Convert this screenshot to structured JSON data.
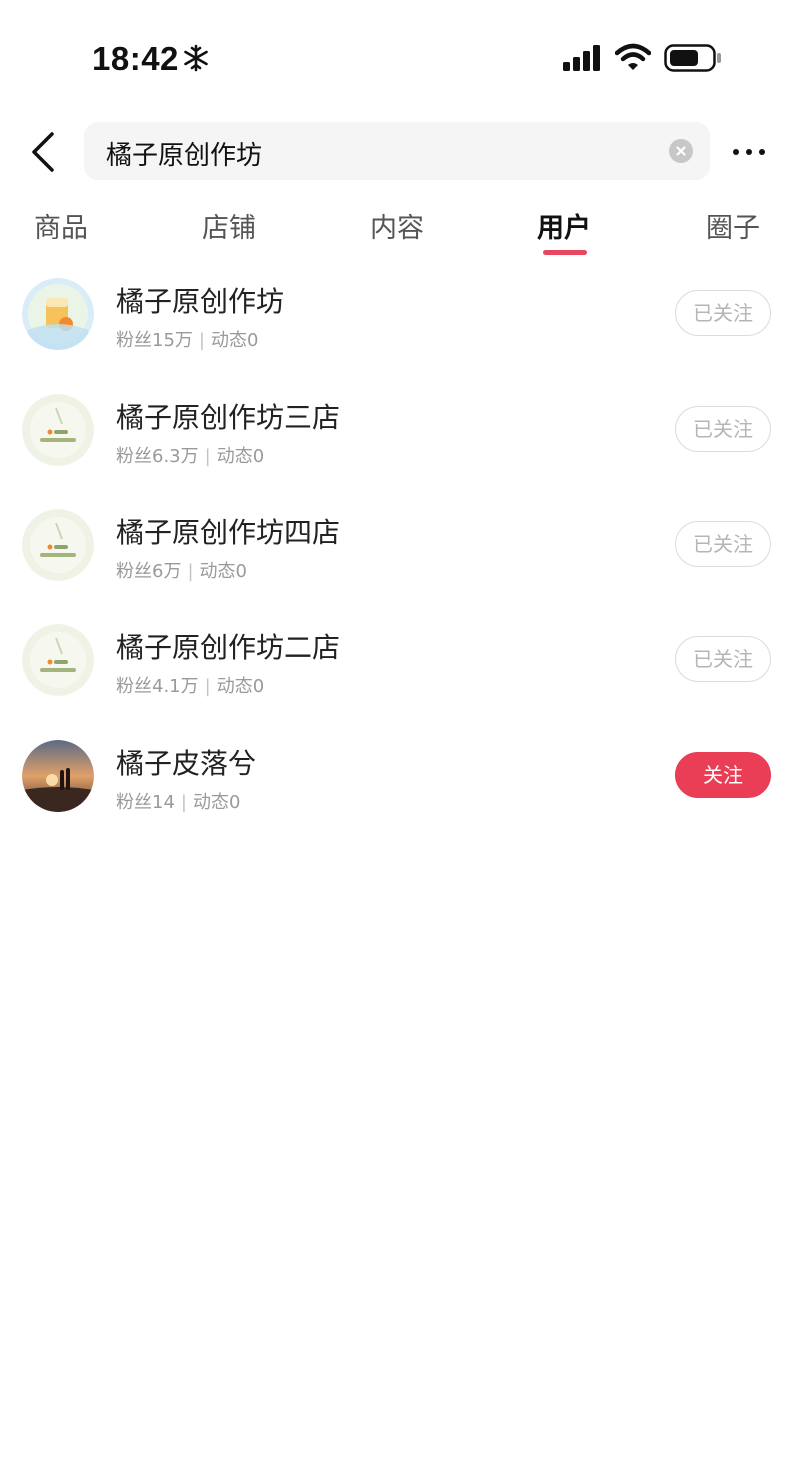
{
  "status_bar": {
    "time": "18:42",
    "extra_icon": "snowflake-icon",
    "signal_icon": "cellular-signal-icon",
    "wifi_icon": "wifi-icon",
    "battery_icon": "battery-icon"
  },
  "header": {
    "back_icon": "chevron-left-icon",
    "search_value": "橘子原创作坊",
    "clear_icon": "clear-circle-icon",
    "more_icon": "more-dots-icon"
  },
  "tabs": [
    {
      "label": "商品",
      "active": false
    },
    {
      "label": "店铺",
      "active": false
    },
    {
      "label": "内容",
      "active": false
    },
    {
      "label": "用户",
      "active": true
    },
    {
      "label": "圈子",
      "active": false
    }
  ],
  "users": [
    {
      "name": "橘子原创作坊",
      "fans": "粉丝15万",
      "posts": "动态0",
      "follow_label": "已关注",
      "followed": true
    },
    {
      "name": "橘子原创作坊三店",
      "fans": "粉丝6.3万",
      "posts": "动态0",
      "follow_label": "已关注",
      "followed": true
    },
    {
      "name": "橘子原创作坊四店",
      "fans": "粉丝6万",
      "posts": "动态0",
      "follow_label": "已关注",
      "followed": true
    },
    {
      "name": "橘子原创作坊二店",
      "fans": "粉丝4.1万",
      "posts": "动态0",
      "follow_label": "已关注",
      "followed": true
    },
    {
      "name": "橘子皮落兮",
      "fans": "粉丝14",
      "posts": "动态0",
      "follow_label": "关注",
      "followed": false
    }
  ],
  "colors": {
    "accent": "#e8475f",
    "follow_button": "#ea3d56",
    "muted_text": "#9a9a9a"
  }
}
